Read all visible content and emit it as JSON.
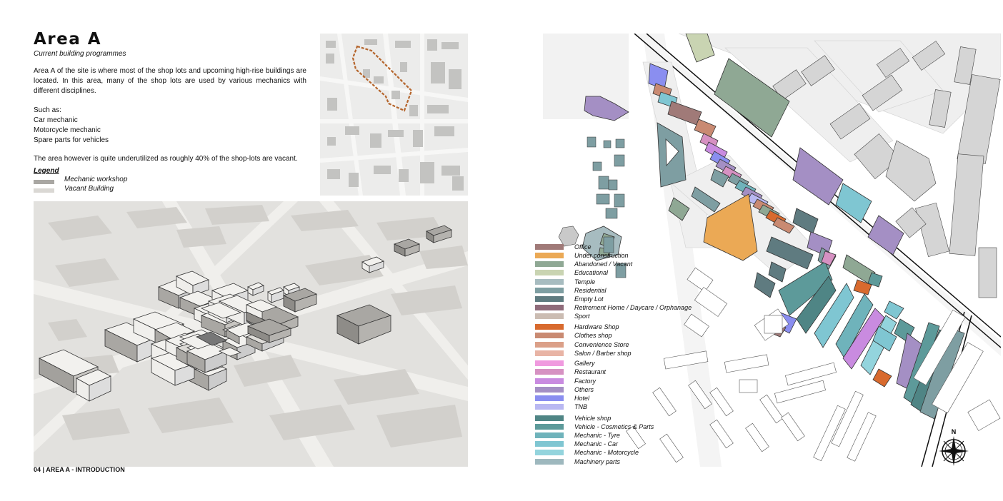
{
  "page": {
    "title": "Area A",
    "subtitle": "Current building programmes",
    "intro": "Area A of the site is where most of the shop lots and upcoming high-rise buildings are located. In this area, many of the shop lots are used by various mechanics with different disciplines.",
    "such_as_label": "Such as:",
    "such_as_items": [
      "Car mechanic",
      "Motorcycle mechanic",
      "Spare parts for vehicles"
    ],
    "underutilized_note": "The area however is quite underutilized as roughly 40% of the shop-lots are vacant.",
    "footer": "04 | AREA A -  INTRODUCTION"
  },
  "left_legend": {
    "title": "Legend",
    "items": [
      {
        "label": "Mechanic workshop",
        "color": "#a9a7a3"
      },
      {
        "label": "Vacant Building",
        "color": "#dad8d4"
      }
    ]
  },
  "programme_legend": [
    {
      "label": "Office",
      "color": "#a07a78"
    },
    {
      "label": "Under construction",
      "color": "#eba955"
    },
    {
      "label": "Abandoned / Vacant",
      "color": "#8fa894"
    },
    {
      "label": "Educational",
      "color": "#c9d4b2"
    },
    {
      "label": "Temple",
      "color": "#a7bcc0"
    },
    {
      "label": "Residential",
      "color": "#7e9ea2"
    },
    {
      "label": "Empty Lot",
      "color": "#5f7b80"
    },
    {
      "label": "Retirement Home / Daycare / Orphanage",
      "color": "#8f6b7a"
    },
    {
      "label": "Sport",
      "color": "#cbbcb2"
    },
    {
      "label": "Hardware Shop",
      "color": "#d86a2e"
    },
    {
      "label": "Clothes shop",
      "color": "#c98a72"
    },
    {
      "label": "Convenience Store",
      "color": "#dba088"
    },
    {
      "label": "Salon / Barber shop",
      "color": "#e8b4a5"
    },
    {
      "label": "Gallery",
      "color": "#f09adf"
    },
    {
      "label": "Restaurant",
      "color": "#d691c2"
    },
    {
      "label": "Factory",
      "color": "#c98be0"
    },
    {
      "label": "Others",
      "color": "#a48fc4"
    },
    {
      "label": "Hotel",
      "color": "#8a8ef0"
    },
    {
      "label": "TNB",
      "color": "#b9b8f2"
    },
    {
      "label": "Vehicle shop",
      "color": "#4f8585"
    },
    {
      "label": "Vehicle - Cosmetics & Parts",
      "color": "#5d9a9a"
    },
    {
      "label": "Mechanic - Tyre",
      "color": "#6fb3bb"
    },
    {
      "label": "Mechanic - Car",
      "color": "#7fc6d2"
    },
    {
      "label": "Mechanic - Motorcycle",
      "color": "#93d4dd"
    },
    {
      "label": "Machinery parts",
      "color": "#9eb8be"
    }
  ],
  "compass": {
    "label": "N"
  },
  "colors": {
    "boundary": "#b5652c",
    "ground": "#e6e5e2",
    "building": "#cfcecb"
  }
}
